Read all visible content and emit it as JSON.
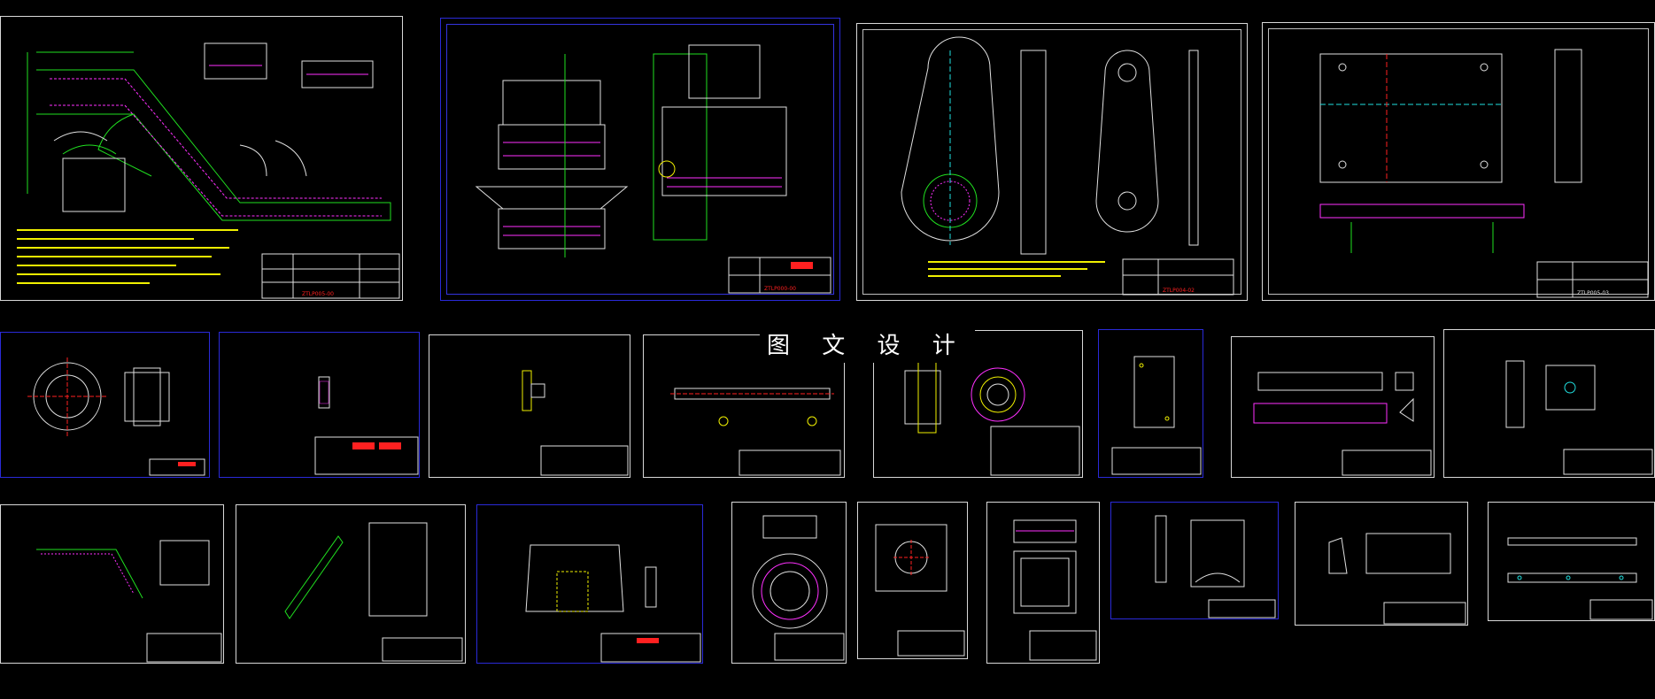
{
  "watermark": {
    "text": "图 文 设 计"
  },
  "drawing_codes": {
    "sheet1": "ZTLP005-00",
    "sheet2": "ZTLP000-00",
    "sheet3": "ZTLP004-02",
    "sheet4": "ZTLP005-03"
  },
  "colors": {
    "background": "#000000",
    "border_white": "#d8d8d8",
    "border_blue": "#2a2ad8",
    "green": "#20e020",
    "magenta": "#ff30ff",
    "yellow": "#f0f000",
    "red": "#ff2020",
    "cyan": "#20e0e0",
    "white": "#e0e0e0"
  }
}
